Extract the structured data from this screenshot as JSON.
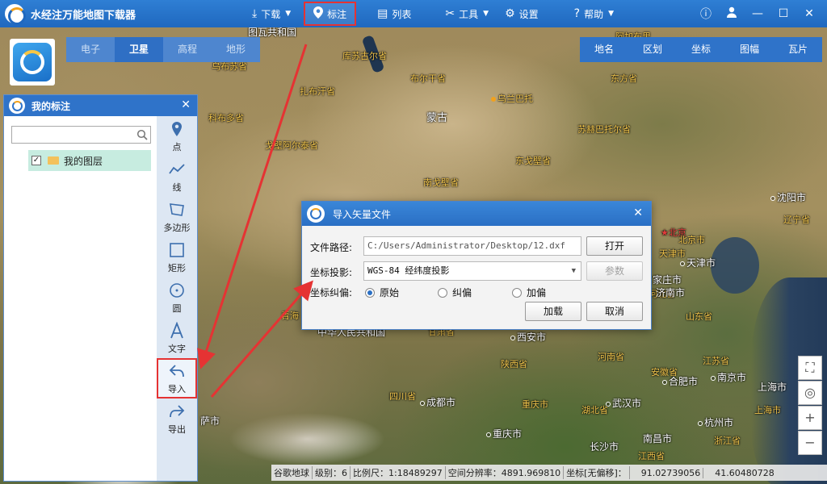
{
  "app": {
    "title": "水经注万能地图下载器"
  },
  "topmenu": [
    {
      "label": "下载",
      "icon": "download-icon",
      "caret": true
    },
    {
      "label": "标注",
      "icon": "pin-icon",
      "caret": false,
      "active": true
    },
    {
      "label": "列表",
      "icon": "list-icon",
      "caret": false
    },
    {
      "label": "工具",
      "icon": "tools-icon",
      "caret": true
    },
    {
      "label": "设置",
      "icon": "gear-icon",
      "caret": false
    },
    {
      "label": "帮助",
      "icon": "help-icon",
      "caret": true
    }
  ],
  "topright": [
    "info-icon",
    "user-icon",
    "minimize-icon",
    "maximize-icon",
    "close-icon"
  ],
  "maptypes": [
    {
      "label": "电子",
      "active": false
    },
    {
      "label": "卫星",
      "active": true
    },
    {
      "label": "高程",
      "active": false
    },
    {
      "label": "地形",
      "active": false
    }
  ],
  "tools": [
    "地名",
    "区划",
    "坐标",
    "图幅",
    "瓦片"
  ],
  "panel": {
    "title": "我的标注",
    "search_placeholder": "",
    "layer": {
      "label": "我的图层",
      "checked": true
    },
    "tools": [
      {
        "label": "点",
        "icon": "point-icon"
      },
      {
        "label": "线",
        "icon": "line-icon"
      },
      {
        "label": "多边形",
        "icon": "polygon-icon"
      },
      {
        "label": "矩形",
        "icon": "rectangle-icon"
      },
      {
        "label": "圆",
        "icon": "circle-icon"
      },
      {
        "label": "文字",
        "icon": "text-icon"
      },
      {
        "label": "导入",
        "icon": "import-icon",
        "highlight": true
      },
      {
        "label": "导出",
        "icon": "export-icon"
      }
    ]
  },
  "dialog": {
    "title": "导入矢量文件",
    "path_label": "文件路径:",
    "path_value": "C:/Users/Administrator/Desktop/12.dxf",
    "open_label": "打开",
    "proj_label": "坐标投影:",
    "proj_value": "WGS-84 经纬度投影",
    "params_label": "参数",
    "offset_label": "坐标纠偏:",
    "offset_options": [
      {
        "label": "原始",
        "checked": true
      },
      {
        "label": "纠偏",
        "checked": false
      },
      {
        "label": "加偏",
        "checked": false
      }
    ],
    "load_label": "加载",
    "cancel_label": "取消"
  },
  "map": {
    "labels": [
      {
        "text": "图瓦共和国",
        "style": "white"
      },
      {
        "text": "库苏古尔省",
        "style": "yellow"
      },
      {
        "text": "阿加布里",
        "style": "yellow"
      },
      {
        "text": "乌布苏省",
        "style": "yellow"
      },
      {
        "text": "布尔干省",
        "style": "yellow"
      },
      {
        "text": "东方省",
        "style": "yellow"
      },
      {
        "text": "扎布汗省",
        "style": "yellow"
      },
      {
        "text": "乌兰巴托",
        "style": "yellow"
      },
      {
        "text": "科布多省",
        "style": "yellow"
      },
      {
        "text": "蒙古",
        "style": "white"
      },
      {
        "text": "苏赫巴托尔省",
        "style": "yellow"
      },
      {
        "text": "戈壁阿尔泰省",
        "style": "yellow"
      },
      {
        "text": "东戈壁省",
        "style": "yellow"
      },
      {
        "text": "南戈壁省",
        "style": "yellow"
      },
      {
        "text": "沈阳市",
        "style": "white"
      },
      {
        "text": "辽宁省",
        "style": "yellow"
      },
      {
        "text": "北京",
        "style": "red"
      },
      {
        "text": "北京市",
        "style": "yellow"
      },
      {
        "text": "天津市",
        "style": "yellow"
      },
      {
        "text": "天津市",
        "style": "white"
      },
      {
        "text": "家庄市",
        "style": "white"
      },
      {
        "text": "河北省",
        "style": "yellow"
      },
      {
        "text": "济南市",
        "style": "white"
      },
      {
        "text": "山东省",
        "style": "yellow"
      },
      {
        "text": "青海",
        "style": "yellow"
      },
      {
        "text": "中华人民共和国",
        "style": "white"
      },
      {
        "text": "甘肃省",
        "style": "yellow"
      },
      {
        "text": "西安市",
        "style": "white"
      },
      {
        "text": "河南省",
        "style": "yellow"
      },
      {
        "text": "江苏省",
        "style": "yellow"
      },
      {
        "text": "陕西省",
        "style": "yellow"
      },
      {
        "text": "安徽省",
        "style": "yellow"
      },
      {
        "text": "合肥市",
        "style": "white"
      },
      {
        "text": "南京市",
        "style": "white"
      },
      {
        "text": "上海市",
        "style": "white"
      },
      {
        "text": "上海市",
        "style": "yellow"
      },
      {
        "text": "四川省",
        "style": "yellow"
      },
      {
        "text": "成都市",
        "style": "white"
      },
      {
        "text": "重庆市",
        "style": "yellow"
      },
      {
        "text": "武汉市",
        "style": "white"
      },
      {
        "text": "湖北省",
        "style": "yellow"
      },
      {
        "text": "杭州市",
        "style": "white"
      },
      {
        "text": "浙江省",
        "style": "yellow"
      },
      {
        "text": "重庆市",
        "style": "white"
      },
      {
        "text": "长沙市",
        "style": "white"
      },
      {
        "text": "南昌市",
        "style": "white"
      },
      {
        "text": "江西省",
        "style": "yellow"
      },
      {
        "text": "萨市",
        "style": "white"
      }
    ]
  },
  "status": {
    "source": "谷歌地球",
    "level": "级别：6",
    "scale": "比例尺：1:18489297",
    "resolution": "空间分辨率：4891.969810",
    "coord_system": "坐标[无偏移]：",
    "lon": "91.02739056",
    "lat": "41.60480728"
  }
}
